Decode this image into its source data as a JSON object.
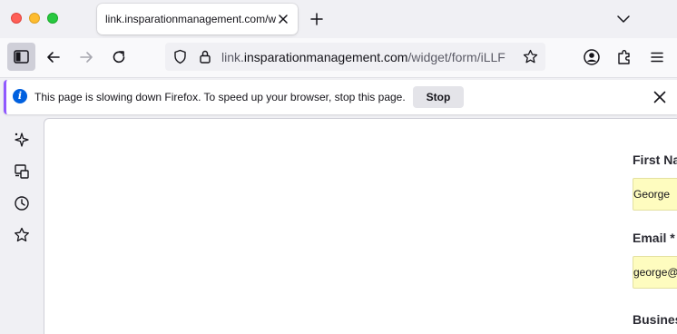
{
  "tab": {
    "title": "link.insparationmanagement.com/widget/form/iLLF"
  },
  "url": {
    "prefix": "link.",
    "domain": "insparationmanagement.com",
    "path": "/widget/form/iLLF"
  },
  "notification": {
    "message": "This page is slowing down Firefox. To speed up your browser, stop this page.",
    "stop_label": "Stop"
  },
  "form": {
    "first_name_label": "First Na",
    "first_name_value": "George",
    "email_label": "Email *",
    "email_value": "george@",
    "business_label": "Busines"
  },
  "colors": {
    "notification_accent": "#9059ff",
    "info_blue": "#0060df",
    "input_fill": "#fefcbf"
  },
  "icons": {
    "sidebar": [
      "ai-sparkle-icon",
      "synced-tabs-icon",
      "history-icon",
      "bookmarks-star-icon"
    ],
    "toolbar": [
      "account-icon",
      "extensions-icon",
      "menu-icon"
    ]
  }
}
